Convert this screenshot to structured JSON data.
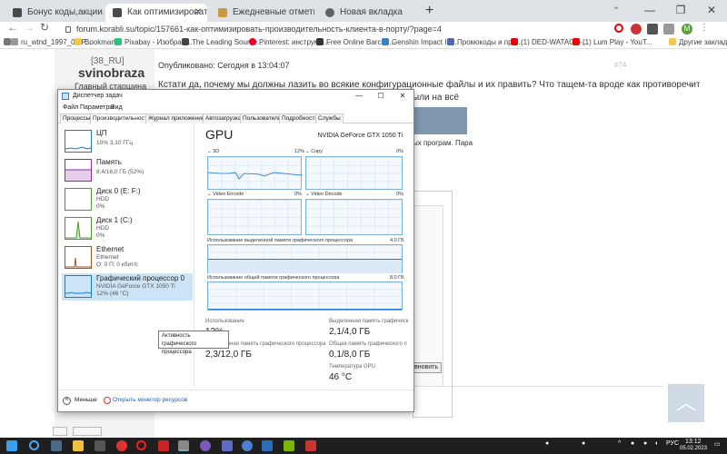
{
  "browser": {
    "tabs": [
      {
        "label": "Бонус коды,акции,подарки,пр..."
      },
      {
        "label": "Как оптимизировать производ..."
      },
      {
        "label": "Ежедневные отметки"
      },
      {
        "label": "Новая вкладка"
      }
    ],
    "new_tab": "+",
    "url": "forum.korabli.su/topic/157661-как-оптимизировать-производительность-клиента-в-порту/?page=4",
    "profile_initial": "M",
    "bookmarks": [
      {
        "label": "ru_wtnd_1997_08.P..."
      },
      {
        "label": "Bookmarks"
      },
      {
        "label": "Pixabay - Изображ..."
      },
      {
        "label": "The Leading Source..."
      },
      {
        "label": "Pinterest: инструме..."
      },
      {
        "label": "Free Online Barcod..."
      },
      {
        "label": "Genshin Impact Int..."
      },
      {
        "label": "Промокоды и про..."
      },
      {
        "label": "(1) DED-WATAGA-..."
      },
      {
        "label": "(1) Lum Play - YouT..."
      },
      {
        "label": "Другие закладки"
      }
    ]
  },
  "forum": {
    "rank": "[38_RU]",
    "nick": "svinobraza",
    "rank_title": "Главный старшина",
    "posted": "Опубликовано: Сегодня в 13:04:07",
    "post_num": "#74",
    "line1": "Кстати да, почему мы должны лазить во всякие конфигурационные файлы и их править? Что тащем-та вроде как противоречит",
    "line2": "ыли на всё",
    "line3": "ых програм. Пара",
    "inner_btn": "вновить"
  },
  "taskmgr": {
    "title": "Диспетчер задач",
    "menu": [
      "Файл",
      "Параметры",
      "Вид"
    ],
    "tabs": [
      "Процессы",
      "Производительность",
      "Журнал приложений",
      "Автозагрузка",
      "Пользователи",
      "Подробности",
      "Службы"
    ],
    "items": [
      {
        "title": "ЦП",
        "sub1": "10% 3,10 ГГц",
        "sub2": "",
        "color": "#1f78c8"
      },
      {
        "title": "Память",
        "sub1": "8,4/16,0 ГБ (52%)",
        "sub2": "",
        "color": "#8b2ea3"
      },
      {
        "title": "Диск 0 (E: F:)",
        "sub1": "HDD",
        "sub2": "0%",
        "color": "#4c9a2a"
      },
      {
        "title": "Диск 1 (C:)",
        "sub1": "HDD",
        "sub2": "0%",
        "color": "#4c9a2a"
      },
      {
        "title": "Ethernet",
        "sub1": "Ethernet",
        "sub2": "О: 0 П: 0 кбит/с",
        "color": "#a7541c"
      },
      {
        "title": "Графический процессор 0",
        "sub1": "NVIDIA GeForce GTX 1050 Ti",
        "sub2": "12% (46 °C)",
        "color": "#1f78c8"
      }
    ],
    "tooltip": "Активность графического процессора",
    "gpu": {
      "header": "GPU",
      "name": "NVIDIA GeForce GTX 1050 Ti",
      "engines": [
        {
          "label": "3D",
          "pct": "12%"
        },
        {
          "label": "Copy",
          "pct": "0%"
        },
        {
          "label": "Video Encode",
          "pct": "0%"
        },
        {
          "label": "Video Decode",
          "pct": "0%"
        }
      ],
      "dedicated_label": "Использование выделенной памяти графического процессора",
      "dedicated_max": "4,0 ГБ",
      "shared_label": "Использование общей памяти графического процессора",
      "shared_max": "8,0 ГБ",
      "stats": [
        {
          "label": "Использование",
          "value": "12%"
        },
        {
          "label": "Выделенная память графическ",
          "value": "2,1/4,0 ГБ"
        },
        {
          "label": "Оперативная память графического процессора",
          "value": "2,3/12,0 ГБ"
        },
        {
          "label": "Общая память графического п",
          "value": "0,1/8,0 ГБ"
        },
        {
          "label": "Температура GPU",
          "value": "46 °C"
        }
      ]
    },
    "footer": {
      "less": "Меньше",
      "monitor": "Открыть монитор ресурсов"
    }
  },
  "taskbar": {
    "lang": "РУС",
    "time": "13:12",
    "date": "05.02.2023"
  }
}
